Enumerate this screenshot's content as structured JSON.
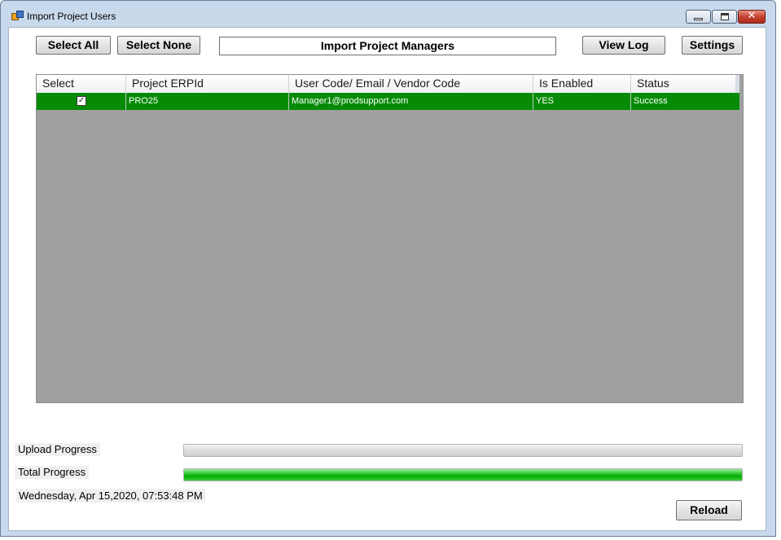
{
  "window": {
    "title": "Import Project Users"
  },
  "toolbar": {
    "select_all": "Select All",
    "select_none": "Select None",
    "import_pm": "Import Project Managers",
    "view_log": "View Log",
    "settings": "Settings"
  },
  "grid": {
    "columns": [
      "Select",
      "Project ERPId",
      "User Code/ Email / Vendor Code",
      "Is Enabled",
      "Status"
    ],
    "rows": [
      {
        "selected": true,
        "check_glyph": "✓",
        "project": "PRO25",
        "user": "Manager1@prodsupport.com",
        "enabled": "YES",
        "status": "Success"
      }
    ]
  },
  "progress": {
    "upload_label": "Upload Progress",
    "upload_value": 0,
    "total_label": "Total Progress",
    "total_value": 1.0
  },
  "status": {
    "datetime": "Wednesday, Apr 15,2020, 07:53:48 PM"
  },
  "reload_label": "Reload",
  "colors": {
    "row_selected": "#078b07",
    "grid_background": "#a0a0a0",
    "progress_green": "#20c020"
  },
  "icons": {
    "app": "app-icon",
    "minimize": "minimize-icon",
    "maximize": "maximize-icon",
    "close": "close-icon"
  }
}
